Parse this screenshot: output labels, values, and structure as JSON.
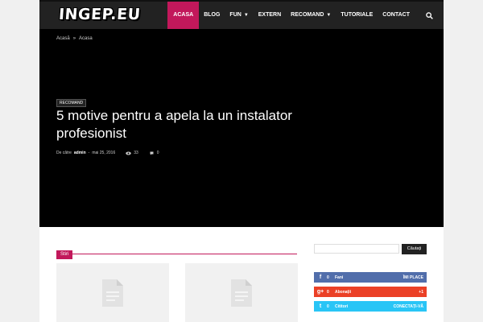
{
  "header": {
    "logo": "INGEP.EU",
    "nav": [
      {
        "label": "ACASA",
        "active": true,
        "dropdown": false
      },
      {
        "label": "BLOG",
        "active": false,
        "dropdown": false
      },
      {
        "label": "FUN",
        "active": false,
        "dropdown": true
      },
      {
        "label": "EXTERN",
        "active": false,
        "dropdown": false
      },
      {
        "label": "RECOMAND",
        "active": false,
        "dropdown": true
      },
      {
        "label": "TUTORIALE",
        "active": false,
        "dropdown": false
      },
      {
        "label": "CONTACT",
        "active": false,
        "dropdown": false
      }
    ],
    "search_icon": "search-icon"
  },
  "breadcrumb": {
    "home": "Acasă",
    "sep": "»",
    "current": "Acasa"
  },
  "article": {
    "category": "RECOMAND",
    "title": "5 motive pentru a apela la un instalator profesionist",
    "by_label": "De către",
    "author": "admin",
    "dash": "-",
    "date": "mai 25, 2016",
    "views": "33",
    "comments": "0"
  },
  "block": {
    "title": "Stiri"
  },
  "sidebar": {
    "search_button": "Căutați",
    "social": [
      {
        "icon": "f",
        "count": "0",
        "label": "Fani",
        "action": "ÎMI PLACE"
      },
      {
        "icon": "g+",
        "count": "0",
        "label": "Abonații",
        "action": "+1"
      },
      {
        "icon": "t",
        "count": "0",
        "label": "Cititori",
        "action": "CONECTAȚI-VĂ"
      }
    ]
  },
  "colors": {
    "accent": "#c2185b",
    "facebook": "#516eab",
    "googleplus": "#eb4026",
    "twitter": "#29c5f6"
  }
}
